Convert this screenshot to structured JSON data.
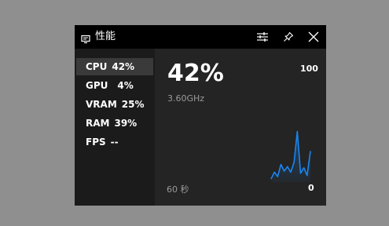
{
  "window": {
    "title": "性能",
    "buttons": [
      "options-icon",
      "pin-icon",
      "close-icon"
    ]
  },
  "metrics": [
    {
      "label": "CPU",
      "value": "42%",
      "selected": true
    },
    {
      "label": "GPU",
      "value": "4%",
      "selected": false
    },
    {
      "label": "VRAM",
      "value": "25%",
      "selected": false
    },
    {
      "label": "RAM",
      "value": "39%",
      "selected": false
    },
    {
      "label": "FPS",
      "value": "--",
      "selected": false
    }
  ],
  "detail": {
    "value": "42%",
    "frequency": "3.60GHz",
    "time_window": "60 秒"
  },
  "chart_data": {
    "type": "line",
    "ylim": [
      0,
      100
    ],
    "ytick_max": "100",
    "ytick_min": "0",
    "color": "#1a86f0",
    "x": [
      0,
      1,
      2,
      3,
      4,
      5,
      6,
      7,
      8,
      9,
      10,
      11,
      12
    ],
    "values": [
      3,
      9,
      5,
      16,
      10,
      14,
      9,
      18,
      46,
      8,
      13,
      6,
      28
    ]
  },
  "colors": {
    "background": "#242424",
    "titlebar": "#000000",
    "selected_row": "#3a3a3a",
    "accent": "#1a86f0"
  }
}
